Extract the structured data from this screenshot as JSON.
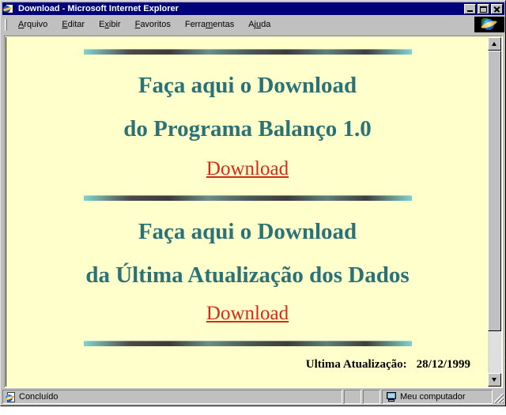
{
  "window": {
    "title": "Download - Microsoft Internet Explorer",
    "title_icon": "ie-page-icon",
    "buttons": {
      "minimize": "_",
      "maximize": "□",
      "close": "×"
    }
  },
  "menubar": {
    "items": [
      {
        "label": "Arquivo",
        "accel": "A"
      },
      {
        "label": "Editar",
        "accel": "E"
      },
      {
        "label": "Exibir",
        "accel": "x"
      },
      {
        "label": "Favoritos",
        "accel": "F"
      },
      {
        "label": "Ferramentas",
        "accel": "m"
      },
      {
        "label": "Ajuda",
        "accel": "u"
      }
    ],
    "logo": "ie-animated-logo"
  },
  "page": {
    "background_color": "#FFFFCC",
    "heading_color": "#2A7276",
    "link_color": "#D42A18",
    "sections": [
      {
        "line1": "Faça aqui o Download",
        "line2": "do Programa Balanço 1.0",
        "link": "Download"
      },
      {
        "line1": "Faça aqui o Download",
        "line2": "da Última Atualização dos Dados",
        "link": "Download"
      }
    ],
    "footer": {
      "label": "Ultima Atualização:",
      "value": "28/12/1999"
    }
  },
  "scrollbar": {
    "up_arrow": "scroll-up-arrow",
    "down_arrow": "scroll-down-arrow"
  },
  "statusbar": {
    "status_text": "Concluído",
    "status_icon": "ie-document-icon",
    "zone_text": "Meu computador",
    "zone_icon": "my-computer-icon"
  }
}
